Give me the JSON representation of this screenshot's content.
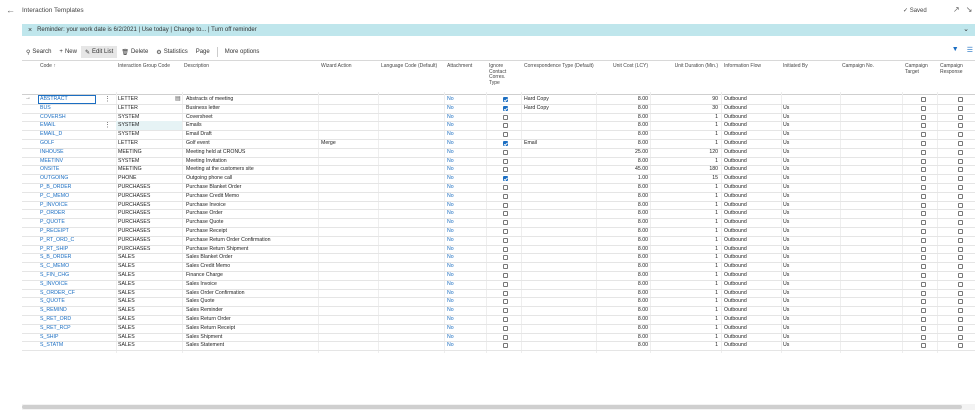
{
  "page": {
    "title": "Interaction Templates",
    "saved_label": "Saved"
  },
  "reminder": {
    "text": "Reminder: your work date is 6/2/2021 | Use today | Change to... | Turn off reminder"
  },
  "toolbar": {
    "search": "Search",
    "new": "New",
    "edit_list": "Edit List",
    "delete": "Delete",
    "statistics": "Statistics",
    "page": "Page",
    "more": "More options"
  },
  "columns": {
    "code": "Code ↑",
    "group": "Interaction Group Code",
    "desc": "Description",
    "wizard": "Wizard Action",
    "lang": "Language Code (Default)",
    "attach": "Attachment",
    "ignore": "Ignore Contact Corres. Type",
    "corr": "Correspondence Type (Default)",
    "cost": "Unit Cost (LCY)",
    "dur": "Unit Duration (Min.)",
    "flow": "Information Flow",
    "init": "Initiated By",
    "camp": "Campaign No.",
    "target": "Campaign Target",
    "resp": "Campaign Response"
  },
  "rows": [
    {
      "code": "ABSTRACT",
      "group": "LETTER",
      "desc": "Abstracts of meeting",
      "wizard": "",
      "attach": "No",
      "ignore": true,
      "corr": "Hard Copy",
      "cost": "8.00",
      "dur": "90",
      "flow": "Outbound",
      "init": "",
      "target": false,
      "resp": false
    },
    {
      "code": "BUS",
      "group": "LETTER",
      "desc": "Business letter",
      "wizard": "",
      "attach": "No",
      "ignore": true,
      "corr": "Hard Copy",
      "cost": "8.00",
      "dur": "30",
      "flow": "Outbound",
      "init": "Us",
      "target": false,
      "resp": false
    },
    {
      "code": "COVERSH",
      "group": "SYSTEM",
      "desc": "Coversheet",
      "wizard": "",
      "attach": "No",
      "ignore": false,
      "corr": "",
      "cost": "8.00",
      "dur": "1",
      "flow": "Outbound",
      "init": "Us",
      "target": false,
      "resp": false
    },
    {
      "code": "EMAIL",
      "group": "SYSTEM",
      "desc": "Emails",
      "wizard": "",
      "attach": "No",
      "ignore": false,
      "corr": "",
      "cost": "8.00",
      "dur": "1",
      "flow": "Outbound",
      "init": "Us",
      "target": false,
      "resp": false
    },
    {
      "code": "EMAIL_D",
      "group": "SYSTEM",
      "desc": "Email Draft",
      "wizard": "",
      "attach": "No",
      "ignore": false,
      "corr": "",
      "cost": "8.00",
      "dur": "1",
      "flow": "Outbound",
      "init": "Us",
      "target": false,
      "resp": false
    },
    {
      "code": "GOLF",
      "group": "LETTER",
      "desc": "Golf event",
      "wizard": "Merge",
      "attach": "No",
      "ignore": true,
      "corr": "Email",
      "cost": "8.00",
      "dur": "1",
      "flow": "Outbound",
      "init": "Us",
      "target": false,
      "resp": false
    },
    {
      "code": "INHOUSE",
      "group": "MEETING",
      "desc": "Meeting held at CRONUS",
      "wizard": "",
      "attach": "No",
      "ignore": false,
      "corr": "",
      "cost": "25.00",
      "dur": "120",
      "flow": "Outbound",
      "init": "Us",
      "target": false,
      "resp": false
    },
    {
      "code": "MEETINV",
      "group": "SYSTEM",
      "desc": "Meeting Invitation",
      "wizard": "",
      "attach": "No",
      "ignore": false,
      "corr": "",
      "cost": "8.00",
      "dur": "1",
      "flow": "Outbound",
      "init": "Us",
      "target": false,
      "resp": false
    },
    {
      "code": "ONSITE",
      "group": "MEETING",
      "desc": "Meeting at the customers site",
      "wizard": "",
      "attach": "No",
      "ignore": false,
      "corr": "",
      "cost": "45.00",
      "dur": "180",
      "flow": "Outbound",
      "init": "Us",
      "target": false,
      "resp": false
    },
    {
      "code": "OUTGOING",
      "group": "PHONE",
      "desc": "Outgoing phone call",
      "wizard": "",
      "attach": "No",
      "ignore": true,
      "corr": "",
      "cost": "1.00",
      "dur": "15",
      "flow": "Outbound",
      "init": "Us",
      "target": false,
      "resp": false
    },
    {
      "code": "P_B_ORDER",
      "group": "PURCHASES",
      "desc": "Purchase Blanket Order",
      "wizard": "",
      "attach": "No",
      "ignore": false,
      "corr": "",
      "cost": "8.00",
      "dur": "1",
      "flow": "Outbound",
      "init": "Us",
      "target": false,
      "resp": false
    },
    {
      "code": "P_C_MEMO",
      "group": "PURCHASES",
      "desc": "Purchase Credit Memo",
      "wizard": "",
      "attach": "No",
      "ignore": false,
      "corr": "",
      "cost": "8.00",
      "dur": "1",
      "flow": "Outbound",
      "init": "Us",
      "target": false,
      "resp": false
    },
    {
      "code": "P_INVOICE",
      "group": "PURCHASES",
      "desc": "Purchase Invoice",
      "wizard": "",
      "attach": "No",
      "ignore": false,
      "corr": "",
      "cost": "8.00",
      "dur": "1",
      "flow": "Outbound",
      "init": "Us",
      "target": false,
      "resp": false
    },
    {
      "code": "P_ORDER",
      "group": "PURCHASES",
      "desc": "Purchase Order",
      "wizard": "",
      "attach": "No",
      "ignore": false,
      "corr": "",
      "cost": "8.00",
      "dur": "1",
      "flow": "Outbound",
      "init": "Us",
      "target": false,
      "resp": false
    },
    {
      "code": "P_QUOTE",
      "group": "PURCHASES",
      "desc": "Purchase Quote",
      "wizard": "",
      "attach": "No",
      "ignore": false,
      "corr": "",
      "cost": "8.00",
      "dur": "1",
      "flow": "Outbound",
      "init": "Us",
      "target": false,
      "resp": false
    },
    {
      "code": "P_RECEIPT",
      "group": "PURCHASES",
      "desc": "Purchase Receipt",
      "wizard": "",
      "attach": "No",
      "ignore": false,
      "corr": "",
      "cost": "8.00",
      "dur": "1",
      "flow": "Outbound",
      "init": "Us",
      "target": false,
      "resp": false
    },
    {
      "code": "P_RT_ORD_C",
      "group": "PURCHASES",
      "desc": "Purchase Return Order Confirmation",
      "wizard": "",
      "attach": "No",
      "ignore": false,
      "corr": "",
      "cost": "8.00",
      "dur": "1",
      "flow": "Outbound",
      "init": "Us",
      "target": false,
      "resp": false
    },
    {
      "code": "P_RT_SHIP",
      "group": "PURCHASES",
      "desc": "Purchase Return Shipment",
      "wizard": "",
      "attach": "No",
      "ignore": false,
      "corr": "",
      "cost": "8.00",
      "dur": "1",
      "flow": "Outbound",
      "init": "Us",
      "target": false,
      "resp": false
    },
    {
      "code": "S_B_ORDER",
      "group": "SALES",
      "desc": "Sales Blanket Order",
      "wizard": "",
      "attach": "No",
      "ignore": false,
      "corr": "",
      "cost": "8.00",
      "dur": "1",
      "flow": "Outbound",
      "init": "Us",
      "target": false,
      "resp": false
    },
    {
      "code": "S_C_MEMO",
      "group": "SALES",
      "desc": "Sales Credit Memo",
      "wizard": "",
      "attach": "No",
      "ignore": false,
      "corr": "",
      "cost": "8.00",
      "dur": "1",
      "flow": "Outbound",
      "init": "Us",
      "target": false,
      "resp": false
    },
    {
      "code": "S_FIN_CHG",
      "group": "SALES",
      "desc": "Finance Charge",
      "wizard": "",
      "attach": "No",
      "ignore": false,
      "corr": "",
      "cost": "8.00",
      "dur": "1",
      "flow": "Outbound",
      "init": "Us",
      "target": false,
      "resp": false
    },
    {
      "code": "S_INVOICE",
      "group": "SALES",
      "desc": "Sales Invoice",
      "wizard": "",
      "attach": "No",
      "ignore": false,
      "corr": "",
      "cost": "8.00",
      "dur": "1",
      "flow": "Outbound",
      "init": "Us",
      "target": false,
      "resp": false
    },
    {
      "code": "S_ORDER_CF",
      "group": "SALES",
      "desc": "Sales Order Confirmation",
      "wizard": "",
      "attach": "No",
      "ignore": false,
      "corr": "",
      "cost": "8.00",
      "dur": "1",
      "flow": "Outbound",
      "init": "Us",
      "target": false,
      "resp": false
    },
    {
      "code": "S_QUOTE",
      "group": "SALES",
      "desc": "Sales Quote",
      "wizard": "",
      "attach": "No",
      "ignore": false,
      "corr": "",
      "cost": "8.00",
      "dur": "1",
      "flow": "Outbound",
      "init": "Us",
      "target": false,
      "resp": false
    },
    {
      "code": "S_REMIND",
      "group": "SALES",
      "desc": "Sales Reminder",
      "wizard": "",
      "attach": "No",
      "ignore": false,
      "corr": "",
      "cost": "8.00",
      "dur": "1",
      "flow": "Outbound",
      "init": "Us",
      "target": false,
      "resp": false
    },
    {
      "code": "S_RET_ORD",
      "group": "SALES",
      "desc": "Sales Return Order",
      "wizard": "",
      "attach": "No",
      "ignore": false,
      "corr": "",
      "cost": "8.00",
      "dur": "1",
      "flow": "Outbound",
      "init": "Us",
      "target": false,
      "resp": false
    },
    {
      "code": "S_RET_RCP",
      "group": "SALES",
      "desc": "Sales Return Receipt",
      "wizard": "",
      "attach": "No",
      "ignore": false,
      "corr": "",
      "cost": "8.00",
      "dur": "1",
      "flow": "Outbound",
      "init": "Us",
      "target": false,
      "resp": false
    },
    {
      "code": "S_SHIP",
      "group": "SALES",
      "desc": "Sales Shipment",
      "wizard": "",
      "attach": "No",
      "ignore": false,
      "corr": "",
      "cost": "8.00",
      "dur": "1",
      "flow": "Outbound",
      "init": "Us",
      "target": false,
      "resp": false
    },
    {
      "code": "S_STATM",
      "group": "SALES",
      "desc": "Sales Statement",
      "wizard": "",
      "attach": "No",
      "ignore": false,
      "corr": "",
      "cost": "8.00",
      "dur": "1",
      "flow": "Outbound",
      "init": "Us",
      "target": false,
      "resp": false
    }
  ]
}
